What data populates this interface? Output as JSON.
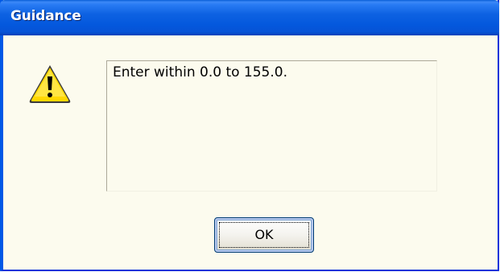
{
  "window": {
    "title": "Guidance"
  },
  "message": {
    "text": "Enter within 0.0 to 155.0.",
    "icon": "warning-icon"
  },
  "buttons": {
    "ok_label": "OK"
  },
  "colors": {
    "titlebar": "#0058e6",
    "client_background": "#fcfbee",
    "dialog_frame": "#0831d9",
    "warning_yellow": "#ffd800"
  }
}
